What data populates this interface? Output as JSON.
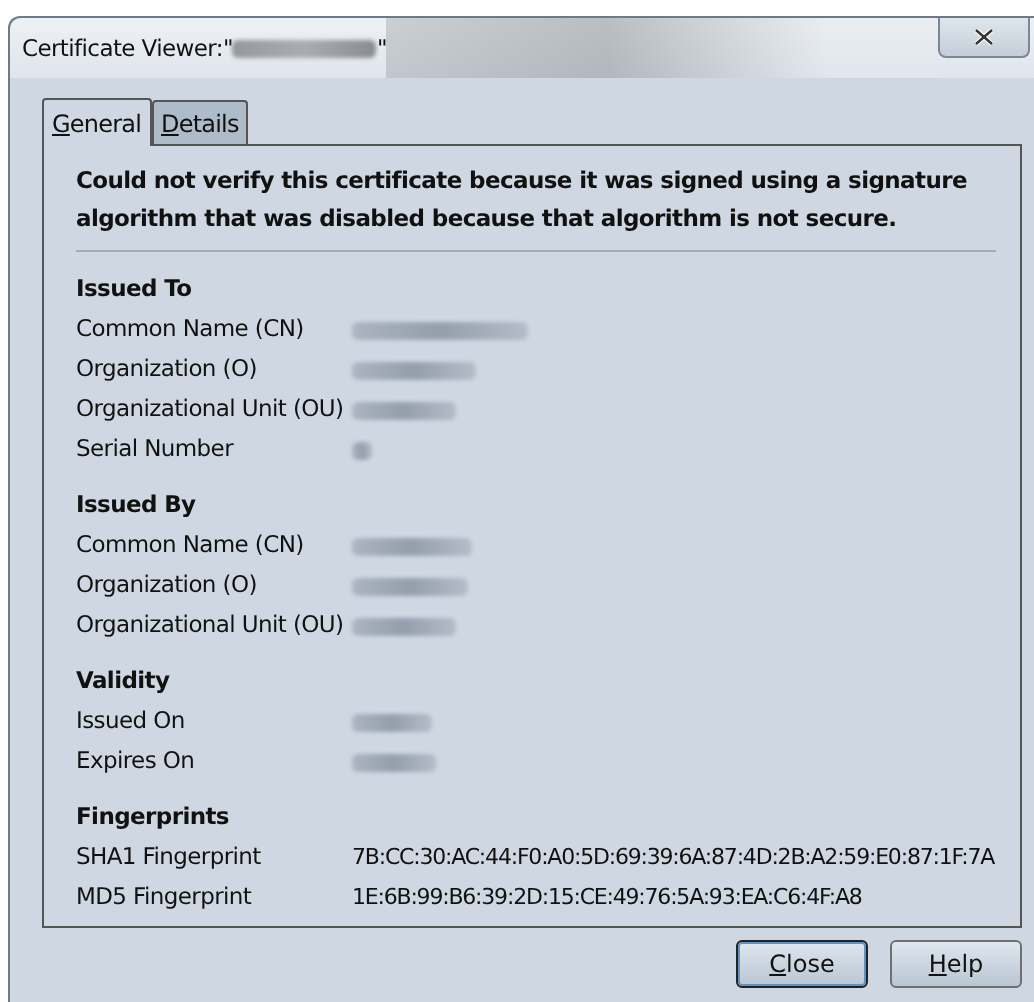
{
  "window": {
    "title": "Certificate Viewer:\"",
    "title_end": "\""
  },
  "tabs": [
    {
      "label": "General",
      "selected": true
    },
    {
      "label": "Details",
      "selected": false
    }
  ],
  "warning": "Could not verify this certificate because it was signed using a signature algorithm that was disabled because that algorithm is not secure.",
  "sections": [
    {
      "heading": "Issued To",
      "rows": [
        {
          "label": "Common Name (CN)",
          "kind": "redacted"
        },
        {
          "label": "Organization (O)",
          "kind": "redacted"
        },
        {
          "label": "Organizational Unit (OU)",
          "kind": "redacted"
        },
        {
          "label": "Serial Number",
          "kind": "redacted"
        }
      ]
    },
    {
      "heading": "Issued By",
      "rows": [
        {
          "label": "Common Name (CN)",
          "kind": "redacted"
        },
        {
          "label": "Organization (O)",
          "kind": "redacted"
        },
        {
          "label": "Organizational Unit (OU)",
          "kind": "redacted"
        }
      ]
    },
    {
      "heading": "Validity",
      "rows": [
        {
          "label": "Issued On",
          "kind": "redacted"
        },
        {
          "label": "Expires On",
          "kind": "redacted"
        }
      ]
    },
    {
      "heading": "Fingerprints",
      "rows": [
        {
          "label": "SHA1 Fingerprint",
          "kind": "text",
          "value": "7B:CC:30:AC:44:F0:A0:5D:69:39:6A:87:4D:2B:A2:59:E0:87:1F:7A"
        },
        {
          "label": "MD5 Fingerprint",
          "kind": "text",
          "value": "1E:6B:99:B6:39:2D:15:CE:49:76:5A:93:EA:C6:4F:A8"
        }
      ]
    }
  ],
  "buttons": [
    {
      "label": "Close",
      "default": true
    },
    {
      "label": "Help",
      "default": false
    }
  ]
}
